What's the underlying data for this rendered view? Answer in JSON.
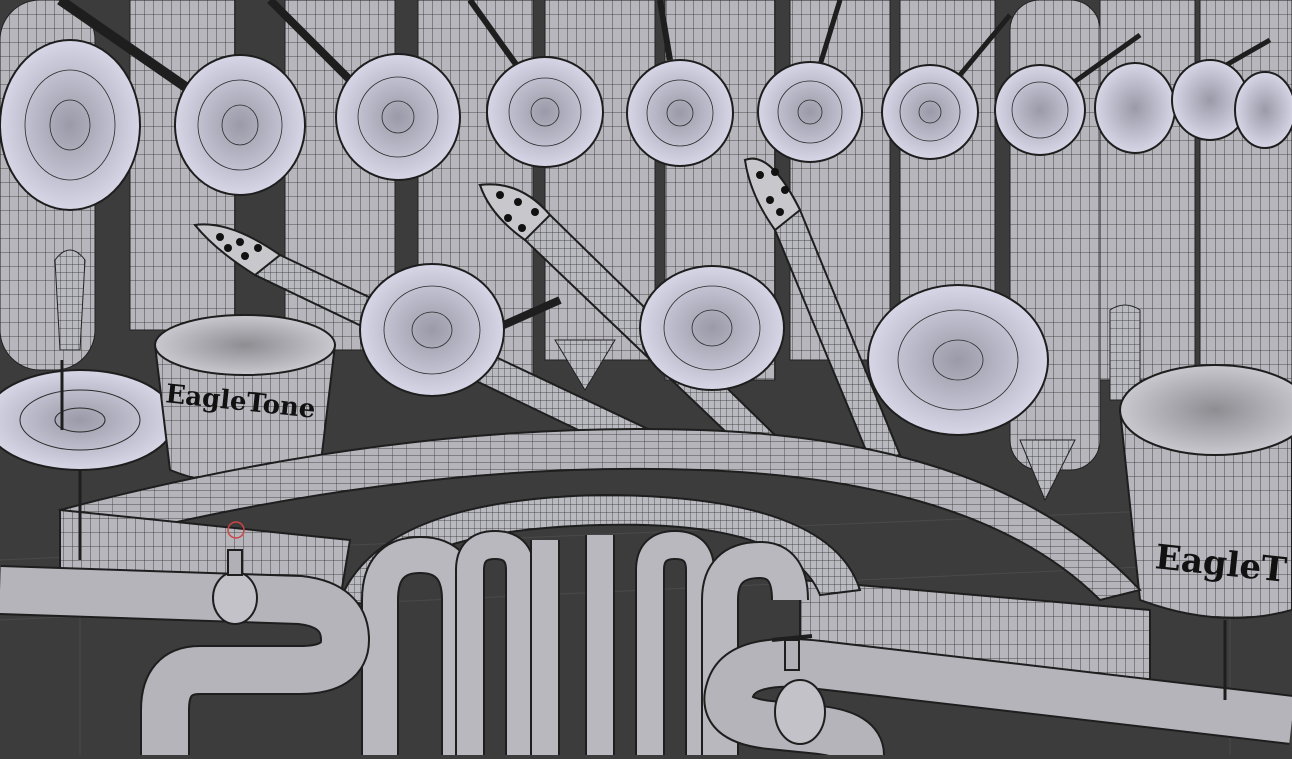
{
  "scene": {
    "background_color": "#3c3c3c",
    "mesh_fill": "#b4b4ba",
    "mesh_fill_bright": "#cfd0e0",
    "wire_color": "#1e1e1e",
    "drum_labels": [
      "EagleTone",
      "EagleT"
    ]
  }
}
